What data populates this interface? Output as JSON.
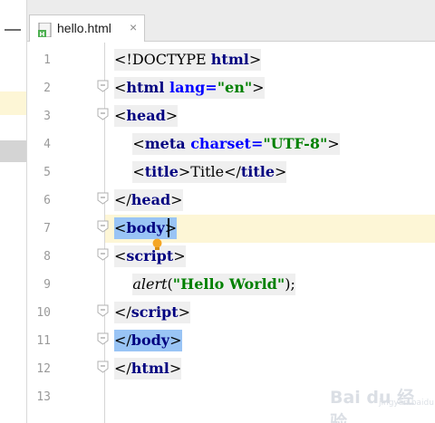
{
  "tab": {
    "file_name": "hello.html",
    "file_icon": "html-file-icon",
    "close_icon": "close-icon",
    "close_glyph": "×"
  },
  "editor": {
    "line_numbers": [
      "1",
      "2",
      "3",
      "4",
      "5",
      "6",
      "7",
      "8",
      "9",
      "10",
      "11",
      "12",
      "13"
    ],
    "lines": [
      [
        {
          "t": "<!DOCTYPE ",
          "c": "tk-text"
        },
        {
          "t": "html",
          "c": "tk-tag"
        },
        {
          "t": ">",
          "c": "tk-text"
        }
      ],
      [
        {
          "t": "<",
          "c": "tk-text"
        },
        {
          "t": "html ",
          "c": "tk-tag"
        },
        {
          "t": "lang=",
          "c": "tk-attr"
        },
        {
          "t": "\"en\"",
          "c": "tk-val"
        },
        {
          "t": ">",
          "c": "tk-text"
        }
      ],
      [
        {
          "t": "<",
          "c": "tk-text"
        },
        {
          "t": "head",
          "c": "tk-tag"
        },
        {
          "t": ">",
          "c": "tk-text"
        }
      ],
      [
        {
          "t": "    ",
          "c": "tk-plain"
        },
        {
          "t": "<",
          "c": "tk-text"
        },
        {
          "t": "meta ",
          "c": "tk-tag"
        },
        {
          "t": "charset=",
          "c": "tk-attr"
        },
        {
          "t": "\"UTF-8\"",
          "c": "tk-val"
        },
        {
          "t": ">",
          "c": "tk-text"
        }
      ],
      [
        {
          "t": "    ",
          "c": "tk-plain"
        },
        {
          "t": "<",
          "c": "tk-text"
        },
        {
          "t": "title",
          "c": "tk-tag"
        },
        {
          "t": ">Title</",
          "c": "tk-text"
        },
        {
          "t": "title",
          "c": "tk-tag"
        },
        {
          "t": ">",
          "c": "tk-text"
        }
      ],
      [
        {
          "t": "</",
          "c": "tk-text"
        },
        {
          "t": "head",
          "c": "tk-tag"
        },
        {
          "t": ">",
          "c": "tk-text"
        }
      ],
      [
        {
          "t": "<",
          "c": "tk-text"
        },
        {
          "t": "body",
          "c": "tk-tag"
        },
        {
          "t": ">",
          "c": "tk-text"
        }
      ],
      [
        {
          "t": "<",
          "c": "tk-text"
        },
        {
          "t": "script",
          "c": "tk-tag"
        },
        {
          "t": ">",
          "c": "tk-text"
        }
      ],
      [
        {
          "t": "    ",
          "c": "tk-plain"
        },
        {
          "t": "alert",
          "c": "tk-italic"
        },
        {
          "t": "(",
          "c": "tk-text"
        },
        {
          "t": "\"Hello World\"",
          "c": "tk-str"
        },
        {
          "t": ");",
          "c": "tk-text"
        }
      ],
      [
        {
          "t": "</",
          "c": "tk-text"
        },
        {
          "t": "script",
          "c": "tk-tag"
        },
        {
          "t": ">",
          "c": "tk-text"
        }
      ],
      [
        {
          "t": "</",
          "c": "tk-text"
        },
        {
          "t": "body",
          "c": "tk-tag"
        },
        {
          "t": ">",
          "c": "tk-text"
        }
      ],
      [
        {
          "t": "</",
          "c": "tk-text"
        },
        {
          "t": "html",
          "c": "tk-tag"
        },
        {
          "t": ">",
          "c": "tk-text"
        }
      ],
      []
    ],
    "selected_lines": [
      7,
      11
    ],
    "current_line": 7,
    "fold_lines": [
      2,
      3,
      6,
      7,
      8,
      10,
      11,
      12
    ]
  },
  "colors": {
    "tag": "#000080",
    "attribute": "#0000ff",
    "value": "#008000",
    "selection": "#99c4f5",
    "current_line": "#fdf6d6"
  },
  "watermark": {
    "text": "Bai du 经验",
    "subtext": "jingyan.baidu.com"
  }
}
